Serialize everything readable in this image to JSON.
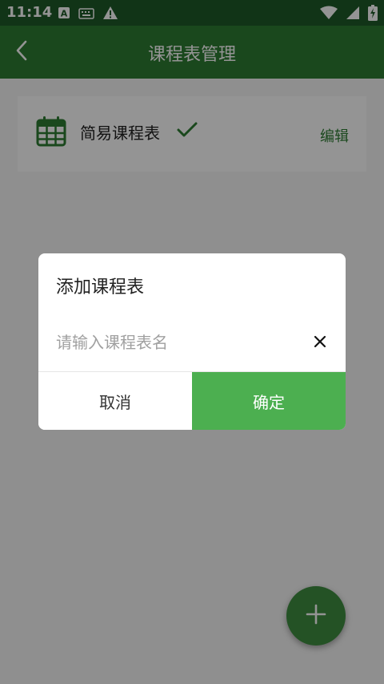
{
  "status_bar": {
    "time": "11:14",
    "icons": [
      "font-a-icon",
      "keyboard-icon",
      "warning-icon",
      "wifi-icon",
      "signal-icon",
      "battery-charging-icon"
    ]
  },
  "app_bar": {
    "title": "课程表管理",
    "back_icon": "back-arrow-icon"
  },
  "schedule_list": {
    "items": [
      {
        "name": "简易课程表",
        "icon": "calendar-icon",
        "selected_icon": "checkmark-icon",
        "edit_label": "编辑"
      }
    ]
  },
  "fab": {
    "icon": "plus-icon"
  },
  "dialog": {
    "title": "添加课程表",
    "input": {
      "value": "",
      "placeholder": "请输入课程表名"
    },
    "clear_icon": "close-icon",
    "cancel_label": "取消",
    "confirm_label": "确定"
  },
  "colors": {
    "primary_dark": "#1e5a28",
    "primary": "#2e7d32",
    "accent": "#4caf50",
    "scrim": "#000000"
  }
}
